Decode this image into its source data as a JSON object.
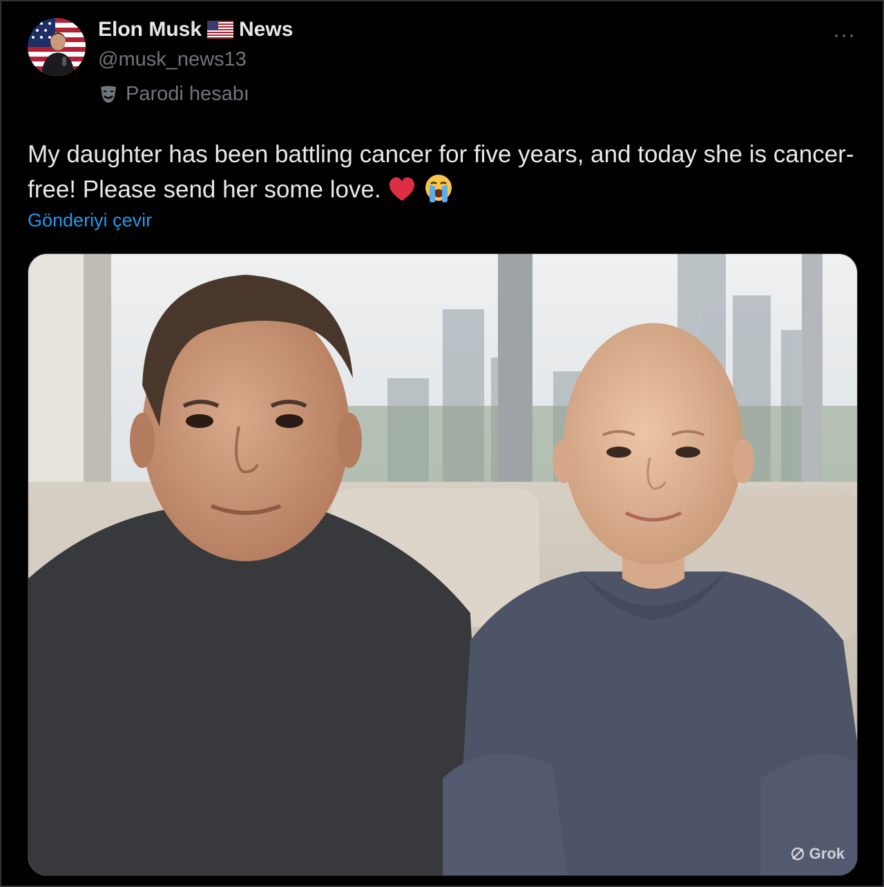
{
  "post": {
    "author": {
      "name_part1": "Elon Musk",
      "flag": "US flag",
      "name_part2": "News",
      "handle": "@musk_news13",
      "parody_label": "Parodi hesabı",
      "avatar_icon": "avatar-icon"
    },
    "more_label": "···",
    "text": "My daughter has been battling cancer for five years, and today she is cancer-free! Please send her some love.",
    "emojis": [
      "heart-icon",
      "crying-face-icon"
    ],
    "translate_label": "Gönderiyi çevir",
    "media": {
      "watermark": "Grok"
    }
  },
  "colors": {
    "background": "#000000",
    "text_primary": "#e7e9ea",
    "text_secondary": "#71767b",
    "link": "#1d9bf0",
    "border": "#2f3336"
  }
}
